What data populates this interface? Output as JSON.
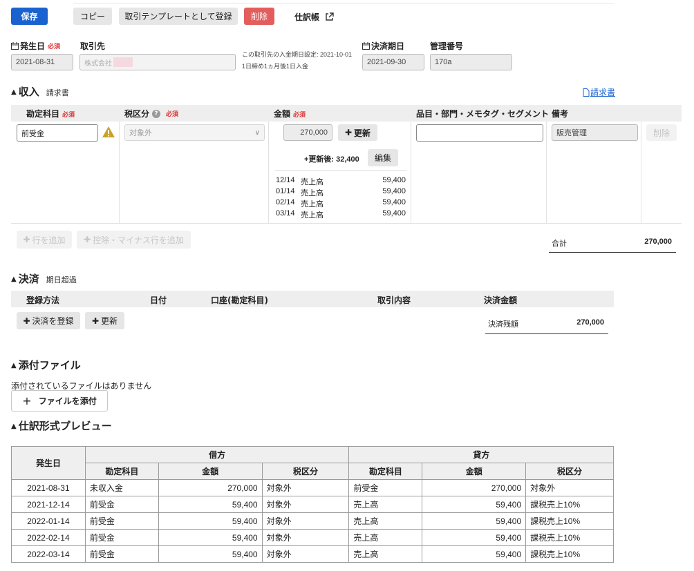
{
  "toolbar": {
    "save": "保存",
    "copy": "コピー",
    "template": "取引テンプレートとして登録",
    "delete": "削除",
    "journal": "仕訳帳"
  },
  "form": {
    "issue_date_label": "発生日",
    "required": "必須",
    "issue_date": "2021-08-31",
    "partner_label": "取引先",
    "partner_value": "株式会社",
    "partner_note_1": "この取引先の入金期日設定: 2021-10-01",
    "partner_note_2": "1日締め1ヵ月後1日入金",
    "due_date_label": "決済期日",
    "due_date": "2021-09-30",
    "ref_label": "管理番号",
    "ref_value": "170a"
  },
  "income": {
    "title": "収入",
    "subtitle": "請求書",
    "invoice_link": "請求書",
    "headers": {
      "account": "勘定科目",
      "tax": "税区分",
      "amount": "金額",
      "item": "品目・部門・メモタグ・セグメント",
      "note": "備考"
    },
    "row": {
      "account": "前受金",
      "tax": "対象外",
      "amount": "270,000",
      "update": "更新",
      "after_update": "+更新後: 32,400",
      "edit": "編集",
      "note": "販売管理",
      "delete": "削除"
    },
    "schedule": [
      {
        "date": "12/14",
        "account": "売上高",
        "amount": "59,400"
      },
      {
        "date": "01/14",
        "account": "売上高",
        "amount": "59,400"
      },
      {
        "date": "02/14",
        "account": "売上高",
        "amount": "59,400"
      },
      {
        "date": "03/14",
        "account": "売上高",
        "amount": "59,400"
      }
    ],
    "add_row": "行を追加",
    "add_minus_row": "控除・マイナス行を追加",
    "total_label": "合計",
    "total_value": "270,000"
  },
  "settlement": {
    "title": "決済",
    "subtitle": "期日超過",
    "headers": {
      "method": "登録方法",
      "date": "日付",
      "account": "口座(勘定科目)",
      "content": "取引内容",
      "amount": "決済金額"
    },
    "register": "決済を登録",
    "update": "更新",
    "balance_label": "決済残額",
    "balance_value": "270,000"
  },
  "attachment": {
    "title": "添付ファイル",
    "empty": "添付されているファイルはありません",
    "add": "ファイルを添付"
  },
  "preview": {
    "title": "仕訳形式プレビュー",
    "headers": {
      "date": "発生日",
      "debit": "借方",
      "credit": "貸方",
      "account": "勘定科目",
      "amount": "金額",
      "tax": "税区分"
    },
    "rows": [
      {
        "date": "2021-08-31",
        "d_acc": "未収入金",
        "d_amt": "270,000",
        "d_tax": "対象外",
        "c_acc": "前受金",
        "c_amt": "270,000",
        "c_tax": "対象外"
      },
      {
        "date": "2021-12-14",
        "d_acc": "前受金",
        "d_amt": "59,400",
        "d_tax": "対象外",
        "c_acc": "売上高",
        "c_amt": "59,400",
        "c_tax": "課税売上10%"
      },
      {
        "date": "2022-01-14",
        "d_acc": "前受金",
        "d_amt": "59,400",
        "d_tax": "対象外",
        "c_acc": "売上高",
        "c_amt": "59,400",
        "c_tax": "課税売上10%"
      },
      {
        "date": "2022-02-14",
        "d_acc": "前受金",
        "d_amt": "59,400",
        "d_tax": "対象外",
        "c_acc": "売上高",
        "c_amt": "59,400",
        "c_tax": "課税売上10%"
      },
      {
        "date": "2022-03-14",
        "d_acc": "前受金",
        "d_amt": "59,400",
        "d_tax": "対象外",
        "c_acc": "売上高",
        "c_amt": "59,400",
        "c_tax": "課税売上10%"
      }
    ]
  },
  "colors": {
    "primary": "#1a62cf",
    "danger": "#e35d5d",
    "warning": "#c9a227",
    "link": "#1a62cf"
  }
}
